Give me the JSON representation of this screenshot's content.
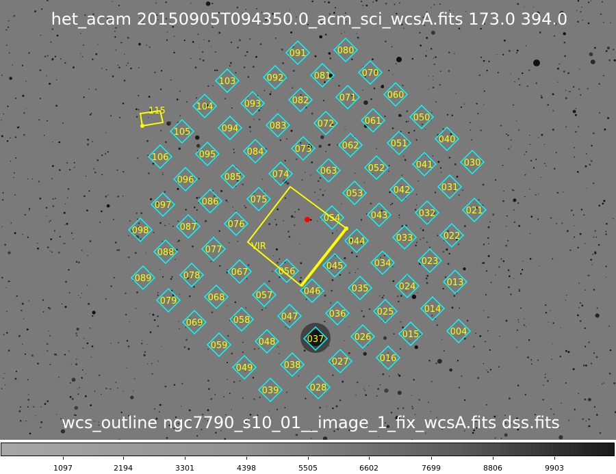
{
  "header": {
    "title": "het_acam 20150905T094350.0_acm_sci_wcsA.fits 173.0 394.0"
  },
  "footer": {
    "title": "wcs_outline ngc7790_s10_01__image_1_fix_wcsA.fits dss.fits"
  },
  "colors": {
    "sky_background": "#7a7a7a",
    "ifu_outline": "#00ffff",
    "ifu_label": "#ffff00",
    "wcs_outline": "#ffff00",
    "center_marker": "#ff0000"
  },
  "overlay": {
    "vir_label": "VIR",
    "probe_label": "115",
    "ifus": [
      "004",
      "013",
      "014",
      "015",
      "016",
      "021",
      "022",
      "023",
      "024",
      "025",
      "026",
      "027",
      "028",
      "030",
      "031",
      "032",
      "033",
      "034",
      "035",
      "036",
      "037",
      "038",
      "039",
      "040",
      "041",
      "042",
      "043",
      "044",
      "045",
      "046",
      "047",
      "048",
      "049",
      "050",
      "051",
      "052",
      "053",
      "054",
      "056",
      "057",
      "058",
      "059",
      "060",
      "061",
      "062",
      "063",
      "067",
      "068",
      "069",
      "070",
      "071",
      "072",
      "073",
      "074",
      "075",
      "076",
      "077",
      "078",
      "079",
      "080",
      "081",
      "082",
      "083",
      "084",
      "085",
      "086",
      "087",
      "088",
      "089",
      "091",
      "092",
      "093",
      "094",
      "095",
      "096",
      "097",
      "098",
      "103",
      "104",
      "105",
      "106"
    ]
  },
  "colorbar": {
    "ticks": [
      "1097",
      "2194",
      "3301",
      "4398",
      "5505",
      "6602",
      "7699",
      "8806",
      "9903"
    ]
  }
}
